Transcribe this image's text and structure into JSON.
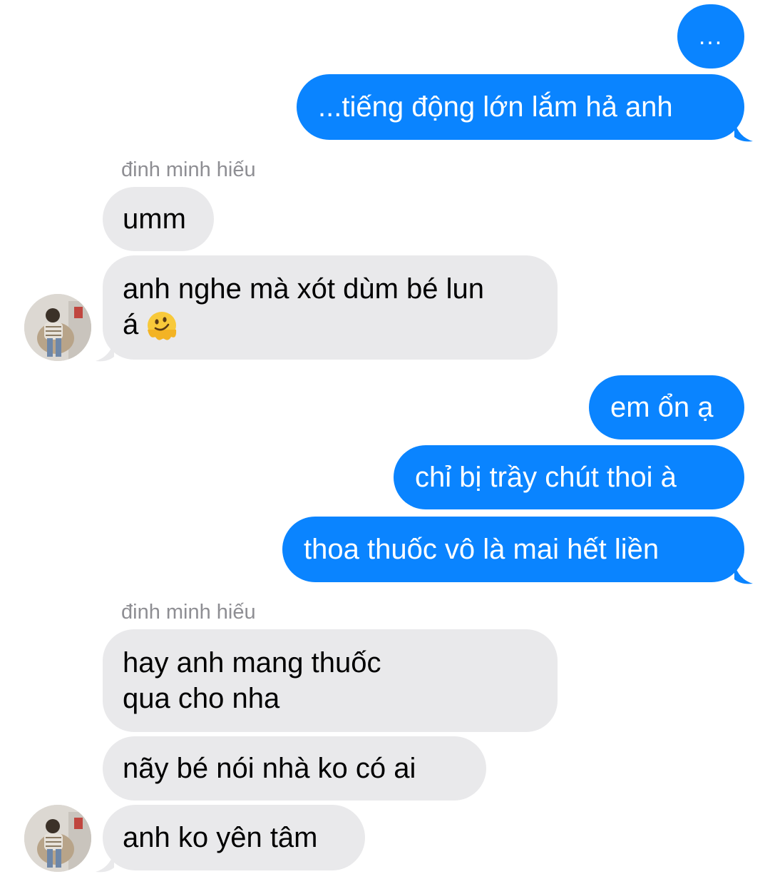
{
  "conversation": {
    "messages": [
      {
        "text": "...",
        "direction": "outgoing"
      },
      {
        "text": "...tiếng động lớn lắm hả anh",
        "direction": "outgoing"
      },
      {
        "sender": "đinh minh hiếu"
      },
      {
        "text": "umm",
        "direction": "incoming"
      },
      {
        "text": "anh nghe mà xót dùm bé lun",
        "text2": "á",
        "emoji": "melting-face-emoji",
        "direction": "incoming"
      },
      {
        "text": "em ổn ạ",
        "direction": "outgoing"
      },
      {
        "text": "chỉ bị trầy chút thoi à",
        "direction": "outgoing"
      },
      {
        "text": "thoa thuốc vô là mai hết liền",
        "direction": "outgoing"
      },
      {
        "sender": "đinh minh hiếu"
      },
      {
        "text": "hay anh mang thuốc qua cho nha",
        "direction": "incoming"
      },
      {
        "text": "nãy bé nói nhà ko có ai",
        "direction": "incoming"
      },
      {
        "text": "anh ko yên tâm",
        "direction": "incoming"
      }
    ]
  },
  "colors": {
    "outgoing_bubble": "#0a84ff",
    "incoming_bubble": "#e9e9eb",
    "sender_label": "#8e8e93"
  }
}
